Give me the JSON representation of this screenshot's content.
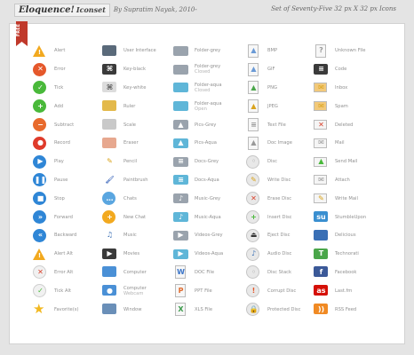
{
  "header": {
    "title": "Eloquence!",
    "subtitle": "Iconset",
    "author": "By Supratim Nayak, 2010-",
    "set_description": "Set of Seventy-Five 32 px X 32 px Icons"
  },
  "badge": {
    "label": "FREE"
  },
  "columns": [
    [
      {
        "label": "Alert",
        "sub": "",
        "icon": "alert-icon",
        "color": "#f2a91f",
        "shape": "tri",
        "sym": "!"
      },
      {
        "label": "Error",
        "sub": "",
        "icon": "error-icon",
        "color": "#e5582b",
        "shape": "circle",
        "sym": "✕"
      },
      {
        "label": "Tick",
        "sub": "",
        "icon": "tick-icon",
        "color": "#49b93a",
        "shape": "circle",
        "sym": "✓"
      },
      {
        "label": "Add",
        "sub": "",
        "icon": "add-icon",
        "color": "#49b93a",
        "shape": "circle",
        "sym": "+"
      },
      {
        "label": "Subtract",
        "sub": "",
        "icon": "subtract-icon",
        "color": "#e86a2c",
        "shape": "circle",
        "sym": "−"
      },
      {
        "label": "Record",
        "sub": "",
        "icon": "record-icon",
        "color": "#df3b2b",
        "shape": "circle",
        "sym": "●"
      },
      {
        "label": "Play",
        "sub": "",
        "icon": "play-icon",
        "color": "#2f86d6",
        "shape": "circle",
        "sym": "▶"
      },
      {
        "label": "Pause",
        "sub": "",
        "icon": "pause-icon",
        "color": "#2f86d6",
        "shape": "circle",
        "sym": "❚❚"
      },
      {
        "label": "Stop",
        "sub": "",
        "icon": "stop-icon",
        "color": "#2f86d6",
        "shape": "circle",
        "sym": "■"
      },
      {
        "label": "Forward",
        "sub": "",
        "icon": "forward-icon",
        "color": "#2f86d6",
        "shape": "circle",
        "sym": "»"
      },
      {
        "label": "Backward",
        "sub": "",
        "icon": "backward-icon",
        "color": "#2f86d6",
        "shape": "circle",
        "sym": "«"
      },
      {
        "label": "Alert Alt",
        "sub": "",
        "icon": "alert-alt-icon",
        "color": "#f2a91f",
        "shape": "tri",
        "sym": "!"
      },
      {
        "label": "Error Alt",
        "sub": "",
        "icon": "error-alt-icon",
        "color": "#f1f1f1",
        "shape": "circle-alt",
        "sym": "✕",
        "symcolor": "#d9412b"
      },
      {
        "label": "Tick Alt",
        "sub": "",
        "icon": "tick-alt-icon",
        "color": "#f1f1f1",
        "shape": "circle-alt",
        "sym": "✓",
        "symcolor": "#49b93a"
      },
      {
        "label": "Favorite(s)",
        "sub": "",
        "icon": "star-icon",
        "color": "#f2b820",
        "shape": "star",
        "sym": "★"
      }
    ],
    [
      {
        "label": "User Interface",
        "sub": "",
        "icon": "user-interface-icon",
        "color": "#5a6a7a",
        "shape": "win",
        "sym": ""
      },
      {
        "label": "Key-black",
        "sub": "",
        "icon": "key-black-icon",
        "color": "#3a3a3a",
        "shape": "win",
        "sym": "⌘"
      },
      {
        "label": "Key-white",
        "sub": "",
        "icon": "key-white-icon",
        "color": "#dcdcdc",
        "shape": "win",
        "sym": "⌘",
        "symcolor": "#555"
      },
      {
        "label": "Ruler",
        "sub": "",
        "icon": "ruler-icon",
        "color": "#e3b94b",
        "shape": "win",
        "sym": ""
      },
      {
        "label": "Scale",
        "sub": "",
        "icon": "scale-icon",
        "color": "#c9c9c9",
        "shape": "win",
        "sym": ""
      },
      {
        "label": "Eraser",
        "sub": "",
        "icon": "eraser-icon",
        "color": "#e7a88f",
        "shape": "win",
        "sym": ""
      },
      {
        "label": "Pencil",
        "sub": "",
        "icon": "pencil-icon",
        "color": "#f2c230",
        "shape": "none",
        "sym": "✎",
        "symcolor": "#d9a31d"
      },
      {
        "label": "Paintbrush",
        "sub": "",
        "icon": "paintbrush-icon",
        "color": "#6b8fd6",
        "shape": "none",
        "sym": "🖌",
        "symcolor": "#5b7fc6"
      },
      {
        "label": "Chats",
        "sub": "",
        "icon": "chats-icon",
        "color": "#5aa6e0",
        "shape": "circle",
        "sym": "…"
      },
      {
        "label": "New Chat",
        "sub": "",
        "icon": "new-chat-icon",
        "color": "#f2a91f",
        "shape": "circle",
        "sym": "+"
      },
      {
        "label": "Music",
        "sub": "",
        "icon": "music-icon",
        "color": "#ffffff",
        "shape": "none",
        "sym": "♫",
        "symcolor": "#3a6fb5"
      },
      {
        "label": "Movies",
        "sub": "",
        "icon": "movies-icon",
        "color": "#3a3a3a",
        "shape": "win",
        "sym": "▶"
      },
      {
        "label": "Computer",
        "sub": "",
        "icon": "computer-icon",
        "color": "#4a90d6",
        "shape": "win",
        "sym": ""
      },
      {
        "label": "Computer",
        "sub": "Webcam",
        "icon": "webcam-icon",
        "color": "#4a90d6",
        "shape": "win",
        "sym": "●"
      },
      {
        "label": "Window",
        "sub": "",
        "icon": "window-icon",
        "color": "#6a8fb8",
        "shape": "win",
        "sym": ""
      }
    ],
    [
      {
        "label": "Folder-grey",
        "sub": "",
        "icon": "folder-grey-icon",
        "color": "#9aa3ad",
        "shape": "folder",
        "sym": ""
      },
      {
        "label": "Folder-grey",
        "sub": "Closed",
        "icon": "folder-grey-closed-icon",
        "color": "#9aa3ad",
        "shape": "folder",
        "sym": ""
      },
      {
        "label": "Folder-aqua",
        "sub": "Closed",
        "icon": "folder-aqua-closed-icon",
        "color": "#5fb6d8",
        "shape": "folder",
        "sym": ""
      },
      {
        "label": "Folder-aqua",
        "sub": "Open",
        "icon": "folder-aqua-open-icon",
        "color": "#5fb6d8",
        "shape": "folder",
        "sym": ""
      },
      {
        "label": "Pics-Grey",
        "sub": "",
        "icon": "pics-grey-icon",
        "color": "#9aa3ad",
        "shape": "folder",
        "sym": "▲"
      },
      {
        "label": "Pics-Aqua",
        "sub": "",
        "icon": "pics-aqua-icon",
        "color": "#5fb6d8",
        "shape": "folder",
        "sym": "▲"
      },
      {
        "label": "Docs-Grey",
        "sub": "",
        "icon": "docs-grey-icon",
        "color": "#9aa3ad",
        "shape": "folder",
        "sym": "≡"
      },
      {
        "label": "Docs-Aqua",
        "sub": "",
        "icon": "docs-aqua-icon",
        "color": "#5fb6d8",
        "shape": "folder",
        "sym": "≡"
      },
      {
        "label": "Music-Grey",
        "sub": "",
        "icon": "music-grey-icon",
        "color": "#9aa3ad",
        "shape": "folder",
        "sym": "♪"
      },
      {
        "label": "Music-Aqua",
        "sub": "",
        "icon": "music-aqua-icon",
        "color": "#5fb6d8",
        "shape": "folder",
        "sym": "♪"
      },
      {
        "label": "Videos-Grey",
        "sub": "",
        "icon": "videos-grey-icon",
        "color": "#9aa3ad",
        "shape": "folder",
        "sym": "▶"
      },
      {
        "label": "Videos-Aqua",
        "sub": "",
        "icon": "videos-aqua-icon",
        "color": "#5fb6d8",
        "shape": "folder",
        "sym": "▶"
      },
      {
        "label": "DOC File",
        "sub": "",
        "icon": "doc-file-icon",
        "color": "#3a74c8",
        "shape": "doc",
        "sym": "W",
        "symcolor": "#3a74c8"
      },
      {
        "label": "PPT File",
        "sub": "",
        "icon": "ppt-file-icon",
        "color": "#e06a2c",
        "shape": "doc",
        "sym": "P",
        "symcolor": "#e06a2c"
      },
      {
        "label": "XLS File",
        "sub": "",
        "icon": "xls-file-icon",
        "color": "#3a9a4a",
        "shape": "doc",
        "sym": "X",
        "symcolor": "#3a9a4a"
      }
    ],
    [
      {
        "label": "BMP",
        "sub": "",
        "icon": "bmp-icon",
        "color": "#6a9ad6",
        "shape": "doc",
        "sym": "▲",
        "symcolor": "#6a9ad6"
      },
      {
        "label": "GIF",
        "sub": "",
        "icon": "gif-icon",
        "color": "#6a9ad6",
        "shape": "doc",
        "sym": "▲",
        "symcolor": "#6a9ad6"
      },
      {
        "label": "PNG",
        "sub": "",
        "icon": "png-icon",
        "color": "#4aa64a",
        "shape": "doc",
        "sym": "▲",
        "symcolor": "#4aa64a"
      },
      {
        "label": "JPEG",
        "sub": "",
        "icon": "jpeg-icon",
        "color": "#d9a31d",
        "shape": "doc",
        "sym": "▲",
        "symcolor": "#d9a31d"
      },
      {
        "label": "Text File",
        "sub": "",
        "icon": "text-file-icon",
        "color": "#999",
        "shape": "doc",
        "sym": "≡",
        "symcolor": "#999"
      },
      {
        "label": "Doc Image",
        "sub": "",
        "icon": "doc-image-icon",
        "color": "#999",
        "shape": "doc",
        "sym": "▲",
        "symcolor": "#999"
      },
      {
        "label": "Disc",
        "sub": "",
        "icon": "disc-icon",
        "color": "#e8e8e8",
        "shape": "disc",
        "sym": "◦",
        "symcolor": "#aaa"
      },
      {
        "label": "Write Disc",
        "sub": "",
        "icon": "write-disc-icon",
        "color": "#e8e8e8",
        "shape": "disc",
        "sym": "✎",
        "symcolor": "#d9a31d"
      },
      {
        "label": "Erase Disc",
        "sub": "",
        "icon": "erase-disc-icon",
        "color": "#e8e8e8",
        "shape": "disc",
        "sym": "✕",
        "symcolor": "#d9412b"
      },
      {
        "label": "Insert Disc",
        "sub": "",
        "icon": "insert-disc-icon",
        "color": "#e8e8e8",
        "shape": "disc",
        "sym": "+",
        "symcolor": "#49b93a"
      },
      {
        "label": "Eject Disc",
        "sub": "",
        "icon": "eject-disc-icon",
        "color": "#e8e8e8",
        "shape": "disc",
        "sym": "⏏",
        "symcolor": "#333"
      },
      {
        "label": "Audio Disc",
        "sub": "",
        "icon": "audio-disc-icon",
        "color": "#e8e8e8",
        "shape": "disc",
        "sym": "♪",
        "symcolor": "#3a6fb5"
      },
      {
        "label": "Disc Stack",
        "sub": "",
        "icon": "disc-stack-icon",
        "color": "#e8e8e8",
        "shape": "disc",
        "sym": "◦",
        "symcolor": "#aaa"
      },
      {
        "label": "Corrupt Disc",
        "sub": "",
        "icon": "corrupt-disc-icon",
        "color": "#e8e8e8",
        "shape": "disc",
        "sym": "!",
        "symcolor": "#e5582b"
      },
      {
        "label": "Protected Disc",
        "sub": "",
        "icon": "protected-disc-icon",
        "color": "#e8e8e8",
        "shape": "disc",
        "sym": "🔒",
        "symcolor": "#d9a31d"
      }
    ],
    [
      {
        "label": "Unknown File",
        "sub": "",
        "icon": "unknown-file-icon",
        "color": "#999",
        "shape": "doc",
        "sym": "?",
        "symcolor": "#999"
      },
      {
        "label": "Code",
        "sub": "",
        "icon": "code-icon",
        "color": "#3a3a3a",
        "shape": "win",
        "sym": "≡"
      },
      {
        "label": "Inbox",
        "sub": "",
        "icon": "inbox-icon",
        "color": "#f2c97a",
        "shape": "mail",
        "sym": "✉",
        "symcolor": "#d9a31d"
      },
      {
        "label": "Spam",
        "sub": "",
        "icon": "spam-icon",
        "color": "#f2c97a",
        "shape": "mail",
        "sym": "✉",
        "symcolor": "#d9a31d"
      },
      {
        "label": "Deleted",
        "sub": "",
        "icon": "deleted-icon",
        "color": "#f5f5f5",
        "shape": "mail",
        "sym": "✕",
        "symcolor": "#d9412b"
      },
      {
        "label": "Mail",
        "sub": "",
        "icon": "mail-icon",
        "color": "#f5f5f5",
        "shape": "mail",
        "sym": "✉",
        "symcolor": "#999"
      },
      {
        "label": "Send Mail",
        "sub": "",
        "icon": "send-mail-icon",
        "color": "#f5f5f5",
        "shape": "mail",
        "sym": "▲",
        "symcolor": "#49b93a"
      },
      {
        "label": "Attach",
        "sub": "",
        "icon": "attach-icon",
        "color": "#f5f5f5",
        "shape": "mail",
        "sym": "✉",
        "symcolor": "#999"
      },
      {
        "label": "Write Mail",
        "sub": "",
        "icon": "write-mail-icon",
        "color": "#f5f5f5",
        "shape": "mail",
        "sym": "✎",
        "symcolor": "#d9a31d"
      },
      {
        "label": "StumbleUpon",
        "sub": "",
        "icon": "stumbleupon-icon",
        "color": "#3a8fd0",
        "shape": "win",
        "sym": "su"
      },
      {
        "label": "Delicious",
        "sub": "",
        "icon": "delicious-icon",
        "color": "#3a6fb5",
        "shape": "win",
        "sym": ""
      },
      {
        "label": "Technorati",
        "sub": "",
        "icon": "technorati-icon",
        "color": "#4aa64a",
        "shape": "win",
        "sym": "T"
      },
      {
        "label": "Facebook",
        "sub": "",
        "icon": "facebook-icon",
        "color": "#3b5998",
        "shape": "win",
        "sym": "f"
      },
      {
        "label": "Last.fm",
        "sub": "",
        "icon": "lastfm-icon",
        "color": "#d51007",
        "shape": "win",
        "sym": "as"
      },
      {
        "label": "RSS Feed",
        "sub": "",
        "icon": "rss-feed-icon",
        "color": "#f08a24",
        "shape": "win",
        "sym": "))"
      }
    ]
  ]
}
